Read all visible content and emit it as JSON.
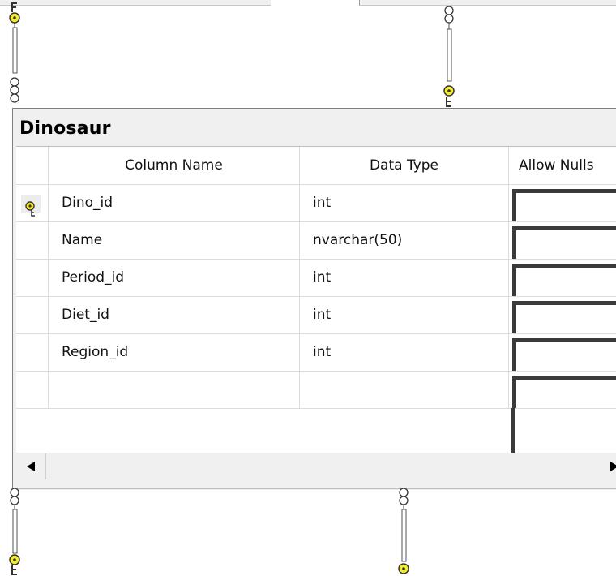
{
  "table": {
    "title": "Dinosaur",
    "columns_header": {
      "name": "Column Name",
      "type": "Data Type",
      "nulls": "Allow Nulls"
    },
    "rows": [
      {
        "name": "Dino_id",
        "type": "int",
        "primary_key": true
      },
      {
        "name": "Name",
        "type": "nvarchar(50)",
        "primary_key": false
      },
      {
        "name": "Period_id",
        "type": "int",
        "primary_key": false
      },
      {
        "name": "Diet_id",
        "type": "int",
        "primary_key": false
      },
      {
        "name": "Region_id",
        "type": "int",
        "primary_key": false
      }
    ]
  },
  "icons": {
    "key": "key-icon",
    "scroll_left": "triangle-left-icon",
    "scroll_right": "triangle-right-icon"
  },
  "colors": {
    "key_yellow": "#f5ec2b",
    "grid_line": "#dcdcdc",
    "panel": "#f0f0f0"
  }
}
